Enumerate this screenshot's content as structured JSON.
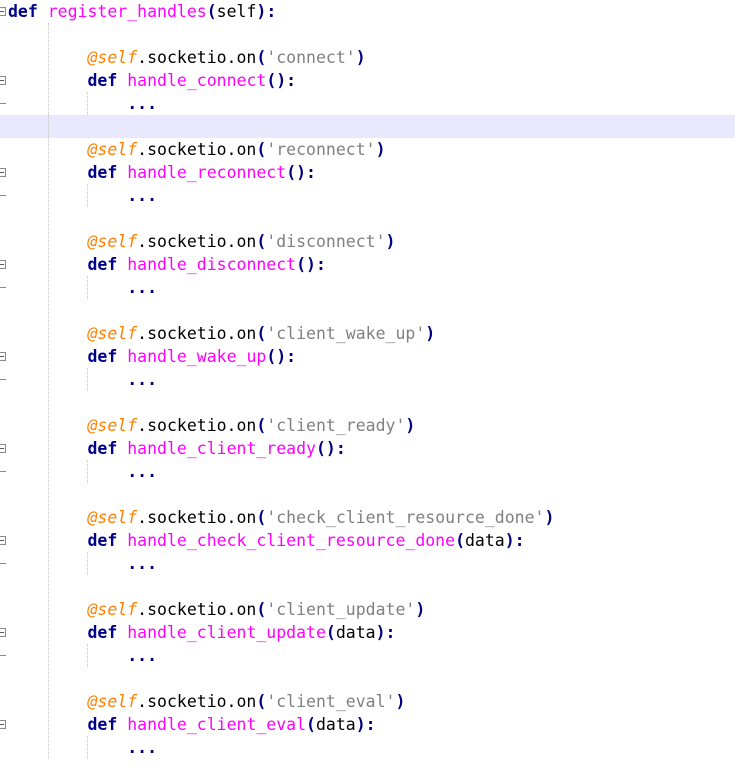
{
  "editor": {
    "language": "python",
    "colors": {
      "keyword": "#00008b",
      "function_name": "#ff00ff",
      "decorator": "#ff8000",
      "string": "#808080",
      "operator": "#000080",
      "current_line": "#e8e8ff"
    },
    "lines": [
      [
        {
          "t": "kw",
          "v": "def"
        },
        {
          "t": "id",
          "v": " "
        },
        {
          "t": "fn",
          "v": "register_handles"
        },
        {
          "t": "op",
          "v": "("
        },
        {
          "t": "id",
          "v": "self"
        },
        {
          "t": "op",
          "v": "):"
        }
      ],
      [],
      [
        {
          "t": "id",
          "v": "        "
        },
        {
          "t": "deco",
          "v": "@self"
        },
        {
          "t": "id",
          "v": ".socketio.on"
        },
        {
          "t": "op",
          "v": "("
        },
        {
          "t": "str",
          "v": "'connect'"
        },
        {
          "t": "op",
          "v": ")"
        }
      ],
      [
        {
          "t": "id",
          "v": "        "
        },
        {
          "t": "kw",
          "v": "def"
        },
        {
          "t": "id",
          "v": " "
        },
        {
          "t": "fn",
          "v": "handle_connect"
        },
        {
          "t": "op",
          "v": "():"
        }
      ],
      [
        {
          "t": "id",
          "v": "            "
        },
        {
          "t": "op",
          "v": "..."
        }
      ],
      [],
      [
        {
          "t": "id",
          "v": "        "
        },
        {
          "t": "deco",
          "v": "@self"
        },
        {
          "t": "id",
          "v": ".socketio.on"
        },
        {
          "t": "op",
          "v": "("
        },
        {
          "t": "str",
          "v": "'reconnect'"
        },
        {
          "t": "op",
          "v": ")"
        }
      ],
      [
        {
          "t": "id",
          "v": "        "
        },
        {
          "t": "kw",
          "v": "def"
        },
        {
          "t": "id",
          "v": " "
        },
        {
          "t": "fn",
          "v": "handle_reconnect"
        },
        {
          "t": "op",
          "v": "():"
        }
      ],
      [
        {
          "t": "id",
          "v": "            "
        },
        {
          "t": "op",
          "v": "..."
        }
      ],
      [],
      [
        {
          "t": "id",
          "v": "        "
        },
        {
          "t": "deco",
          "v": "@self"
        },
        {
          "t": "id",
          "v": ".socketio.on"
        },
        {
          "t": "op",
          "v": "("
        },
        {
          "t": "str",
          "v": "'disconnect'"
        },
        {
          "t": "op",
          "v": ")"
        }
      ],
      [
        {
          "t": "id",
          "v": "        "
        },
        {
          "t": "kw",
          "v": "def"
        },
        {
          "t": "id",
          "v": " "
        },
        {
          "t": "fn",
          "v": "handle_disconnect"
        },
        {
          "t": "op",
          "v": "():"
        }
      ],
      [
        {
          "t": "id",
          "v": "            "
        },
        {
          "t": "op",
          "v": "..."
        }
      ],
      [],
      [
        {
          "t": "id",
          "v": "        "
        },
        {
          "t": "deco",
          "v": "@self"
        },
        {
          "t": "id",
          "v": ".socketio.on"
        },
        {
          "t": "op",
          "v": "("
        },
        {
          "t": "str",
          "v": "'client_wake_up'"
        },
        {
          "t": "op",
          "v": ")"
        }
      ],
      [
        {
          "t": "id",
          "v": "        "
        },
        {
          "t": "kw",
          "v": "def"
        },
        {
          "t": "id",
          "v": " "
        },
        {
          "t": "fn",
          "v": "handle_wake_up"
        },
        {
          "t": "op",
          "v": "():"
        }
      ],
      [
        {
          "t": "id",
          "v": "            "
        },
        {
          "t": "op",
          "v": "..."
        }
      ],
      [],
      [
        {
          "t": "id",
          "v": "        "
        },
        {
          "t": "deco",
          "v": "@self"
        },
        {
          "t": "id",
          "v": ".socketio.on"
        },
        {
          "t": "op",
          "v": "("
        },
        {
          "t": "str",
          "v": "'client_ready'"
        },
        {
          "t": "op",
          "v": ")"
        }
      ],
      [
        {
          "t": "id",
          "v": "        "
        },
        {
          "t": "kw",
          "v": "def"
        },
        {
          "t": "id",
          "v": " "
        },
        {
          "t": "fn",
          "v": "handle_client_ready"
        },
        {
          "t": "op",
          "v": "():"
        }
      ],
      [
        {
          "t": "id",
          "v": "            "
        },
        {
          "t": "op",
          "v": "..."
        }
      ],
      [],
      [
        {
          "t": "id",
          "v": "        "
        },
        {
          "t": "deco",
          "v": "@self"
        },
        {
          "t": "id",
          "v": ".socketio.on"
        },
        {
          "t": "op",
          "v": "("
        },
        {
          "t": "str",
          "v": "'check_client_resource_done'"
        },
        {
          "t": "op",
          "v": ")"
        }
      ],
      [
        {
          "t": "id",
          "v": "        "
        },
        {
          "t": "kw",
          "v": "def"
        },
        {
          "t": "id",
          "v": " "
        },
        {
          "t": "fn",
          "v": "handle_check_client_resource_done"
        },
        {
          "t": "op",
          "v": "("
        },
        {
          "t": "id",
          "v": "data"
        },
        {
          "t": "op",
          "v": "):"
        }
      ],
      [
        {
          "t": "id",
          "v": "            "
        },
        {
          "t": "op",
          "v": "..."
        }
      ],
      [],
      [
        {
          "t": "id",
          "v": "        "
        },
        {
          "t": "deco",
          "v": "@self"
        },
        {
          "t": "id",
          "v": ".socketio.on"
        },
        {
          "t": "op",
          "v": "("
        },
        {
          "t": "str",
          "v": "'client_update'"
        },
        {
          "t": "op",
          "v": ")"
        }
      ],
      [
        {
          "t": "id",
          "v": "        "
        },
        {
          "t": "kw",
          "v": "def"
        },
        {
          "t": "id",
          "v": " "
        },
        {
          "t": "fn",
          "v": "handle_client_update"
        },
        {
          "t": "op",
          "v": "("
        },
        {
          "t": "id",
          "v": "data"
        },
        {
          "t": "op",
          "v": "):"
        }
      ],
      [
        {
          "t": "id",
          "v": "            "
        },
        {
          "t": "op",
          "v": "..."
        }
      ],
      [],
      [
        {
          "t": "id",
          "v": "        "
        },
        {
          "t": "deco",
          "v": "@self"
        },
        {
          "t": "id",
          "v": ".socketio.on"
        },
        {
          "t": "op",
          "v": "("
        },
        {
          "t": "str",
          "v": "'client_eval'"
        },
        {
          "t": "op",
          "v": ")"
        }
      ],
      [
        {
          "t": "id",
          "v": "        "
        },
        {
          "t": "kw",
          "v": "def"
        },
        {
          "t": "id",
          "v": " "
        },
        {
          "t": "fn",
          "v": "handle_client_eval"
        },
        {
          "t": "op",
          "v": "("
        },
        {
          "t": "id",
          "v": "data"
        },
        {
          "t": "op",
          "v": "):"
        }
      ],
      [
        {
          "t": "id",
          "v": "            "
        },
        {
          "t": "op",
          "v": "..."
        }
      ]
    ],
    "current_line_index": 5,
    "fold_marker_lines": [
      0,
      3,
      7,
      11,
      15,
      19,
      23,
      27,
      31
    ],
    "fold_end_lines": [
      4,
      8,
      12,
      16,
      20,
      24,
      28
    ]
  }
}
